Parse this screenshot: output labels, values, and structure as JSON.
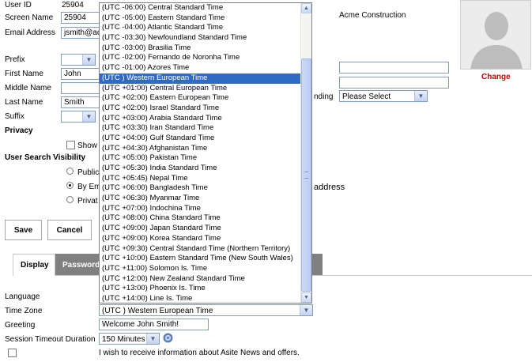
{
  "profile": {
    "user_id_label": "User ID",
    "user_id_value": "25904",
    "screen_name_label": "Screen Name",
    "screen_name_value": "25904",
    "email_label": "Email Address",
    "email_value": "jsmith@acme.com",
    "company": "Acme Construction",
    "prefix_label": "Prefix",
    "first_name_label": "First Name",
    "first_name_value": "John",
    "middle_name_label": "Middle Name",
    "middle_name_value": "",
    "last_name_label": "Last Name",
    "last_name_value": "Smith",
    "suffix_label": "Suffix",
    "privacy_heading": "Privacy",
    "privacy_show_label": "Show",
    "visibility_heading": "User Search Visibility",
    "visibility_public": "Public",
    "visibility_by_email": "By Em",
    "visibility_private": "Privat",
    "visibility_address_suffix": "address",
    "right_label_fragment": "nding",
    "right_select_value": "Please Select",
    "photo_change": "Change"
  },
  "buttons": {
    "save": "Save",
    "cancel": "Cancel"
  },
  "tabs": [
    {
      "label": "Display",
      "active": true
    },
    {
      "label": "Password",
      "active": false
    }
  ],
  "display": {
    "language_label": "Language",
    "time_zone_label": "Time Zone",
    "time_zone_value": "(UTC ) Western European Time",
    "greeting_label": "Greeting",
    "greeting_value": "Welcome John Smith!",
    "session_timeout_label": "Session Timeout Duration",
    "session_timeout_value": "150 Minutes",
    "newsletter_label": "I wish to receive information about Asite News and offers."
  },
  "timezone_dropdown": {
    "selected_index": 7,
    "options": [
      "(UTC -06:00) Central Standard Time",
      "(UTC -05:00) Eastern Standard Time",
      "(UTC -04:00) Atlantic Standard Time",
      "(UTC -03:30) Newfoundland Standard Time",
      "(UTC -03:00) Brasilia Time",
      "(UTC -02:00) Fernando de Noronha Time",
      "(UTC -01:00) Azores Time",
      "(UTC ) Western European Time",
      "(UTC +01:00) Central European Time",
      "(UTC +02:00) Eastern European Time",
      "(UTC +02:00) Israel Standard Time",
      "(UTC +03:00) Arabia Standard Time",
      "(UTC +03:30) Iran Standard Time",
      "(UTC +04:00) Gulf Standard Time",
      "(UTC +04:30) Afghanistan Time",
      "(UTC +05:00) Pakistan Time",
      "(UTC +05:30) India Standard Time",
      "(UTC +05:45) Nepal Time",
      "(UTC +06:00) Bangladesh Time",
      "(UTC +06:30) Myanmar Time",
      "(UTC +07:00) Indochina Time",
      "(UTC +08:00) China Standard Time",
      "(UTC +09:00) Japan Standard Time",
      "(UTC +09:00) Korea Standard Time",
      "(UTC +09:30) Central Standard Time (Northern Territory)",
      "(UTC +10:00) Eastern Standard Time (New South Wales)",
      "(UTC +11:00) Solomon Is. Time",
      "(UTC +12:00) New Zealand Standard Time",
      "(UTC +13:00) Phoenix Is. Time",
      "(UTC +14:00) Line Is. Time"
    ]
  },
  "icons": {
    "dropdown_arrow": "chevron-down-icon",
    "help": "help-icon",
    "avatar": "user-silhouette-icon"
  },
  "colors": {
    "selection": "#316ac5",
    "change_link": "#cc0000",
    "tab_inactive": "#808080"
  }
}
